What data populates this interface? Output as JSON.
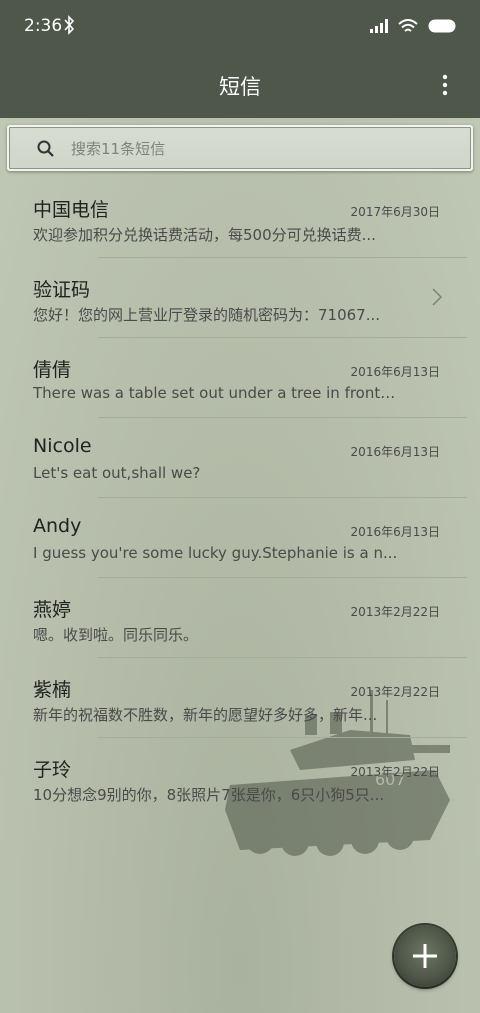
{
  "status": {
    "time": "2:36"
  },
  "header": {
    "title": "短信"
  },
  "search": {
    "placeholder": "搜索11条短信"
  },
  "conversations": [
    {
      "name": "中国电信",
      "date": "2017年6月30日",
      "preview": "欢迎参加积分兑换话费活动，每500分可兑换话费..."
    },
    {
      "name": "验证码",
      "date": "",
      "preview": "您好！您的网上营业厅登录的随机密码为：71067..."
    },
    {
      "name": "倩倩",
      "date": "2016年6月13日",
      "preview": "There was a table set out under a tree in front o..."
    },
    {
      "name": "Nicole",
      "date": "2016年6月13日",
      "preview": "Let's eat out,shall we?"
    },
    {
      "name": "Andy",
      "date": "2016年6月13日",
      "preview": "I guess you're some lucky guy.Stephanie is a n..."
    },
    {
      "name": "燕婷",
      "date": "2013年2月22日",
      "preview": "嗯。收到啦。同乐同乐。"
    },
    {
      "name": "紫楠",
      "date": "2013年2月22日",
      "preview": "新年的祝福数不胜数，新年的愿望好多好多，新年..."
    },
    {
      "name": "子玲",
      "date": "2013年2月22日",
      "preview": "10分想念9别的你，8张照片7张是你，6只小狗5只..."
    }
  ],
  "colors": {
    "toolbar": "#4e5749",
    "background": "#b7c0ad"
  }
}
